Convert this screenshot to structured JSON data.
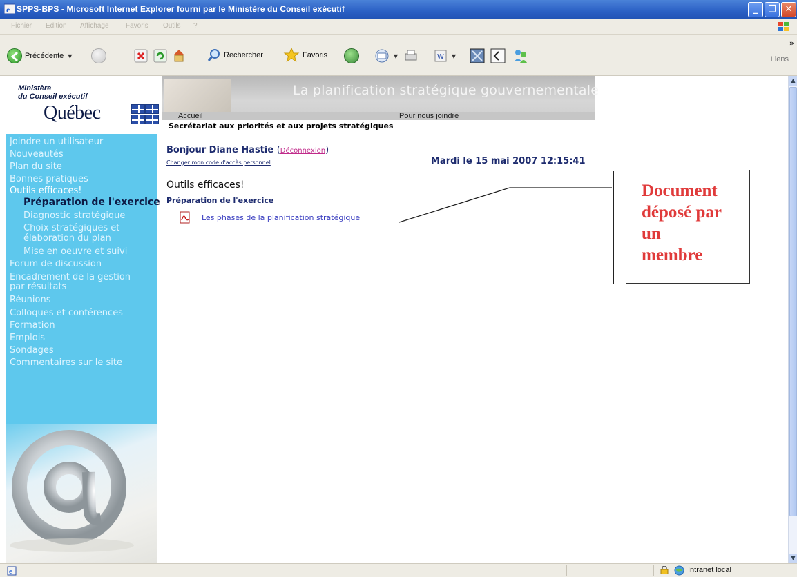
{
  "window": {
    "title": "SPPS-BPS - Microsoft Internet Explorer fourni par le Ministère du Conseil exécutif"
  },
  "menubar": {
    "items": [
      "Fichier",
      "Edition",
      "Affichage",
      "Favoris",
      "Outils",
      "?"
    ]
  },
  "toolbar": {
    "back_label": "Précédente",
    "search_label": "Rechercher",
    "favorites_label": "Favoris",
    "links_label": "Liens"
  },
  "logo": {
    "line1": "Ministère",
    "line2": "du Conseil exécutif",
    "quebec": "Québec"
  },
  "banner": {
    "title": "La planification stratégique gouvernementale",
    "nav_home": "Accueil",
    "nav_contact": "Pour nous joindre",
    "secretariat": "Secrétariat aux priorités et aux projets stratégiques"
  },
  "sidebar": {
    "items": [
      "Joindre un utilisateur",
      "Nouveautés",
      "Plan du site",
      "Bonnes pratiques",
      "Outils efficaces!",
      "Préparation de l'exercice",
      "Diagnostic stratégique",
      "Choix stratégiques et",
      "élaboration du plan",
      "Mise en oeuvre et suivi",
      "Forum de discussion",
      "Encadrement de la gestion",
      "par résultats",
      "Réunions",
      "Colloques et conférences",
      "Formation",
      "Emplois",
      "Sondages",
      "Commentaires sur le site"
    ]
  },
  "user": {
    "greeting": "Bonjour Diane Hastie",
    "logout": "Déconnexion",
    "change_code": "Changer mon code d'accès personnel",
    "date": "Mardi le 15 mai 2007 12:15:41"
  },
  "main": {
    "heading": "Outils efficaces!",
    "subheading": "Préparation de l'exercice",
    "document_link": "Les phases de la planification stratégique"
  },
  "annotation": {
    "lines": [
      "Document",
      "déposé par",
      "un",
      "membre"
    ]
  },
  "statusbar": {
    "zone": "Intranet local"
  }
}
